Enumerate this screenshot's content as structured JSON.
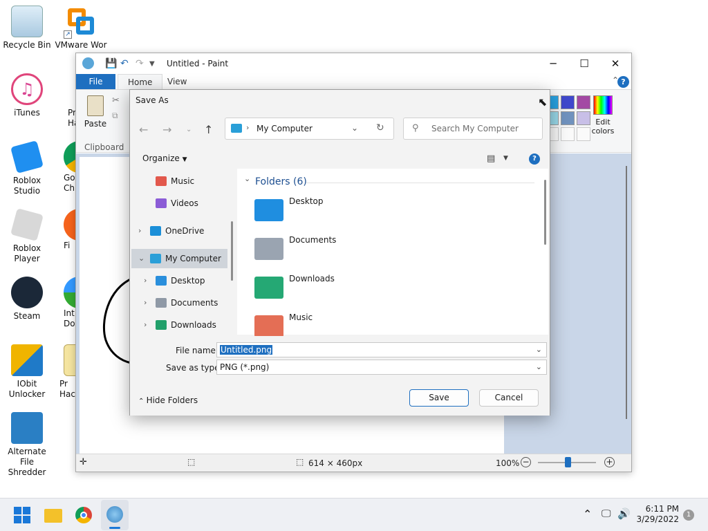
{
  "desktop": {
    "icons": [
      {
        "label": "Recycle Bin",
        "icon": "recycle-bin-icon"
      },
      {
        "label": "VMware Wor",
        "icon": "vmware-icon"
      },
      {
        "label": "iTunes",
        "icon": "itunes-icon"
      },
      {
        "label": "Roblox Studio",
        "icon": "roblox-studio-icon"
      },
      {
        "label": "Roblox Player",
        "icon": "roblox-player-icon"
      },
      {
        "label": "Steam",
        "icon": "steam-icon"
      },
      {
        "label": "IObit Unlocker",
        "icon": "iobit-unlocker-icon"
      },
      {
        "label": "Alternate File Shredder",
        "icon": "file-shredder-icon"
      },
      {
        "label": "Pr Ha",
        "icon": "app-icon"
      },
      {
        "label": "Go Ch",
        "icon": "chrome-icon"
      },
      {
        "label": "Fi",
        "icon": "firefox-icon"
      },
      {
        "label": "Int Dov",
        "icon": "download-manager-icon"
      },
      {
        "label": "Pr Hack",
        "icon": "app-icon"
      }
    ]
  },
  "paint": {
    "title": "Untitled - Paint",
    "tabs": [
      "File",
      "Home",
      "View"
    ],
    "ribbon": {
      "paste_label": "Paste",
      "clipboard_group": "Clipboard",
      "edit_colors_label": "Edit colors",
      "palette": [
        "#29a3e3",
        "#3f48cc",
        "#a349a4",
        "#99d9ea",
        "#7092be",
        "#c8bfe7"
      ]
    },
    "status": {
      "dimensions": "614 × 460px",
      "zoom": "100%"
    },
    "controls": {
      "minimize": "─",
      "maximize": "☐",
      "close": "✕",
      "collapse": "⌃",
      "help": "?"
    }
  },
  "dialog": {
    "title": "Save As",
    "address": "My Computer",
    "search_placeholder": "Search My Computer",
    "organize": "Organize",
    "nav": [
      {
        "label": "Music",
        "color": "#e2584c",
        "expandable": false
      },
      {
        "label": "Videos",
        "color": "#8b5cd6",
        "expandable": false
      },
      {
        "label": "OneDrive",
        "color": "#1b8fd8",
        "expandable": true
      },
      {
        "label": "My Computer",
        "color": "#2a9fd8",
        "expandable": true,
        "selected": true
      },
      {
        "label": "Desktop",
        "color": "#2a8fdc",
        "expandable": true
      },
      {
        "label": "Documents",
        "color": "#8f99a6",
        "expandable": true
      },
      {
        "label": "Downloads",
        "color": "#22a06b",
        "expandable": true
      }
    ],
    "folders_header": "Folders (6)",
    "folders": [
      {
        "name": "Desktop",
        "color": "#1f8ee0"
      },
      {
        "name": "Documents",
        "color": "#9aa4b1"
      },
      {
        "name": "Downloads",
        "color": "#25a874"
      },
      {
        "name": "Music",
        "color": "#e46e55"
      }
    ],
    "file_name_label": "File name:",
    "file_name_value": "Untitled.png",
    "save_type_label": "Save as type:",
    "save_type_value": "PNG (*.png)",
    "hide_folders": "Hide Folders",
    "save_button": "Save",
    "cancel_button": "Cancel"
  },
  "taskbar": {
    "time": "6:11 PM",
    "date": "3/29/2022",
    "notification_count": "1"
  }
}
